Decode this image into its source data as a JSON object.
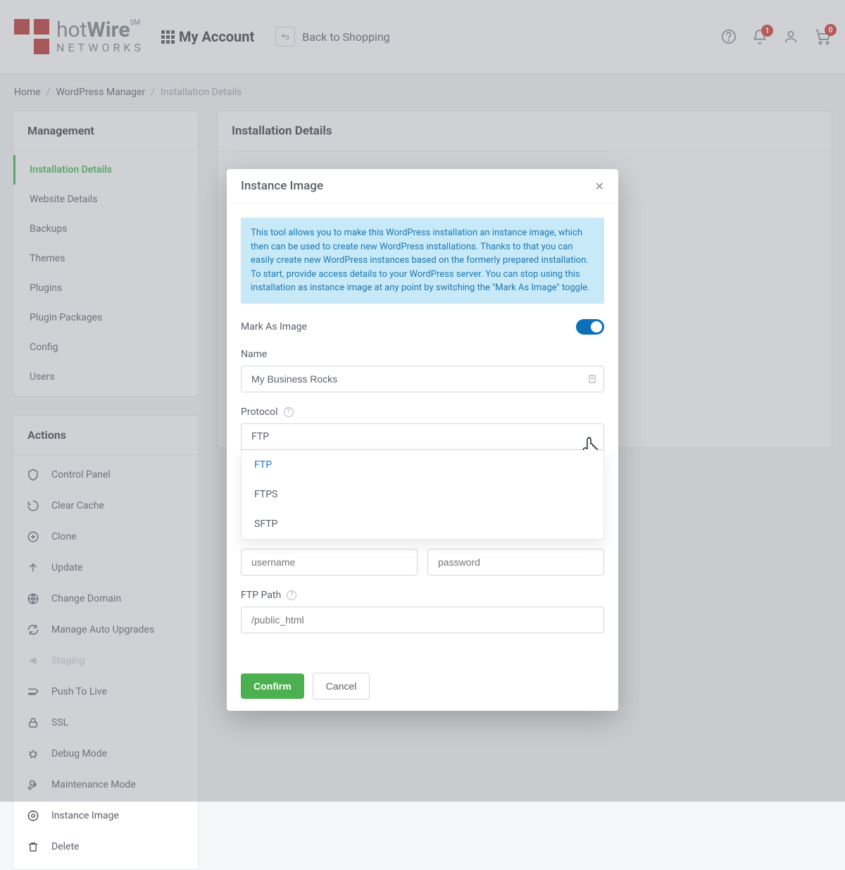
{
  "logo": {
    "top": "hotWire",
    "bottom": "NETWORKS",
    "mark": "SM"
  },
  "header": {
    "my_account": "My Account",
    "back": "Back to Shopping",
    "notif_count": "1",
    "cart_count": "0"
  },
  "breadcrumb": {
    "home": "Home",
    "wp_manager": "WordPress Manager",
    "current": "Installation Details"
  },
  "sidebar": {
    "management_title": "Management",
    "items": [
      {
        "label": "Installation Details",
        "active": true
      },
      {
        "label": "Website Details"
      },
      {
        "label": "Backups"
      },
      {
        "label": "Themes"
      },
      {
        "label": "Plugins"
      },
      {
        "label": "Plugin Packages"
      },
      {
        "label": "Config"
      },
      {
        "label": "Users"
      }
    ],
    "actions_title": "Actions",
    "actions": [
      "Control Panel",
      "Clear Cache",
      "Clone",
      "Update",
      "Change Domain",
      "Manage Auto Upgrades",
      "Staging",
      "Push To Live",
      "SSL",
      "Debug Mode",
      "Maintenance Mode",
      "Instance Image",
      "Delete"
    ]
  },
  "content": {
    "title": "Installation Details"
  },
  "modal": {
    "title": "Instance Image",
    "info": "This tool allows you to make this WordPress installation an instance image, which then can be used to create new WordPress installations. Thanks to that you can easily create new WordPress instances based on the formerly prepared installation. To start, provide access details to your WordPress server. You can stop using this installation as instance image at any point by switching the \"Mark As Image\" toggle.",
    "mark_as_image": "Mark As Image",
    "name_label": "Name",
    "name_value": "My Business Rocks",
    "protocol_label": "Protocol",
    "protocol_value": "FTP",
    "protocol_options": [
      "FTP",
      "FTPS",
      "SFTP"
    ],
    "username_placeholder": "username",
    "password_placeholder": "password",
    "ftp_path_label": "FTP Path",
    "ftp_path_placeholder": "/public_html",
    "confirm": "Confirm",
    "cancel": "Cancel"
  }
}
